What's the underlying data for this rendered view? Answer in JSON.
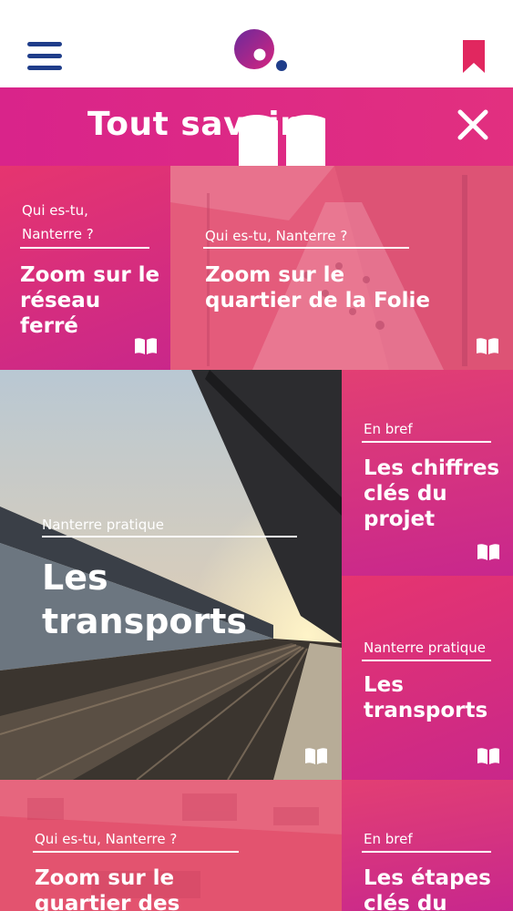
{
  "header": {
    "title": "Tout savoir"
  },
  "tiles": [
    {
      "category": "Qui es-tu,\nNanterre ?",
      "title": "Zoom sur le\nréseau\nferré"
    },
    {
      "category": "Qui es-tu, Nanterre ?",
      "title": "Zoom sur le\nquartier de la Folie"
    },
    {
      "category": "Nanterre pratique",
      "title": "Les\ntransports"
    },
    {
      "category": "En bref",
      "title": "Les chiffres\nclés du\nprojet"
    },
    {
      "category": "Nanterre pratique",
      "title": "Les\ntransports"
    },
    {
      "category": "Qui es-tu, Nanterre ?",
      "title": "Zoom sur le\nquartier des"
    },
    {
      "category": "En bref",
      "title": "Les étapes\nclés du"
    }
  ],
  "colors": {
    "brand_pink": "#d9248a",
    "brand_navy": "#1f3d8a",
    "brand_purple": "#6a2a9a"
  }
}
